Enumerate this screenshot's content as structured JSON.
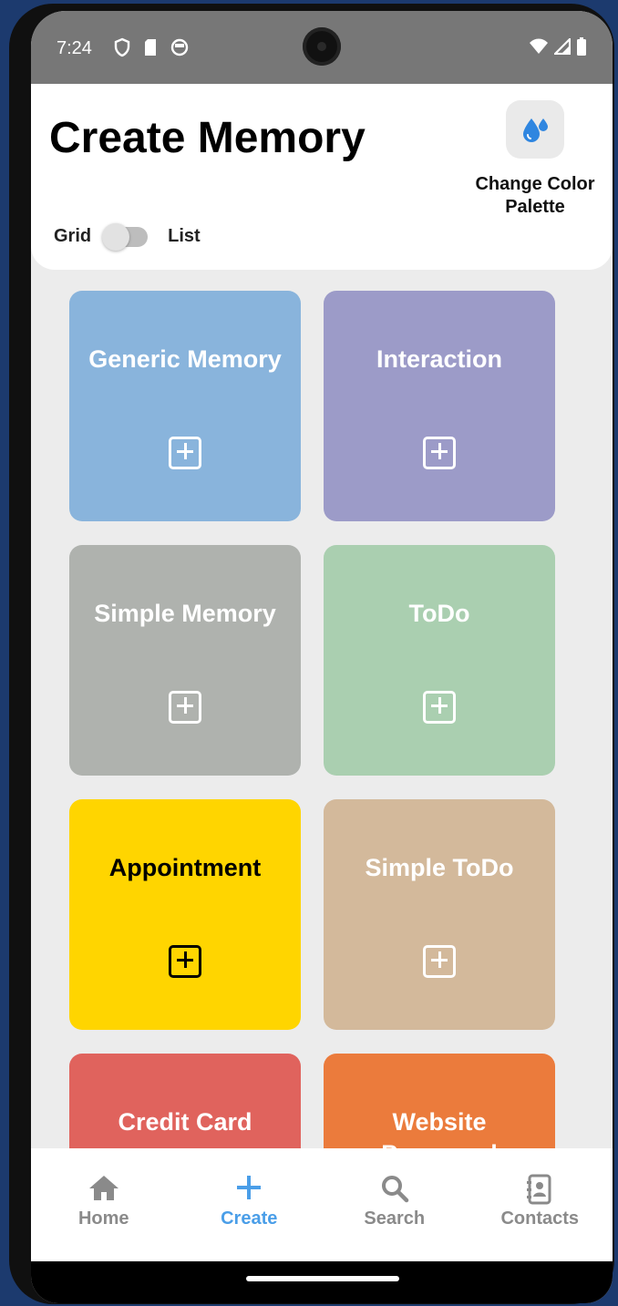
{
  "status_bar": {
    "time": "7:24",
    "left_icons": [
      "shield-icon",
      "sd-card-icon",
      "notification-icon"
    ],
    "right_icons": [
      "wifi-icon",
      "signal-icon",
      "battery-icon"
    ]
  },
  "header": {
    "title": "Create Memory",
    "palette_icon": "water-drops-icon",
    "palette_label": "Change Color Palette",
    "toggle_left": "Grid",
    "toggle_right": "List"
  },
  "tiles": [
    {
      "title": "Generic Memory",
      "color": "#89b4dc",
      "text_color": "#ffffff"
    },
    {
      "title": "Interaction",
      "color": "#9c9bc8",
      "text_color": "#ffffff"
    },
    {
      "title": "Simple Memory",
      "color": "#afb2ae",
      "text_color": "#ffffff"
    },
    {
      "title": "ToDo",
      "color": "#aacfb0",
      "text_color": "#ffffff"
    },
    {
      "title": "Appointment",
      "color": "#ffd500",
      "text_color": "#000000"
    },
    {
      "title": "Simple ToDo",
      "color": "#d3b99b",
      "text_color": "#ffffff"
    },
    {
      "title": "Credit Card",
      "color": "#e0635d",
      "text_color": "#ffffff"
    },
    {
      "title": "Website Password",
      "color": "#eb7b3c",
      "text_color": "#ffffff"
    }
  ],
  "nav": {
    "items": [
      {
        "label": "Home",
        "icon": "home-icon"
      },
      {
        "label": "Create",
        "icon": "plus-icon"
      },
      {
        "label": "Search",
        "icon": "search-icon"
      },
      {
        "label": "Contacts",
        "icon": "contacts-icon"
      }
    ],
    "active": "Create",
    "active_color": "#4a9ee8"
  }
}
